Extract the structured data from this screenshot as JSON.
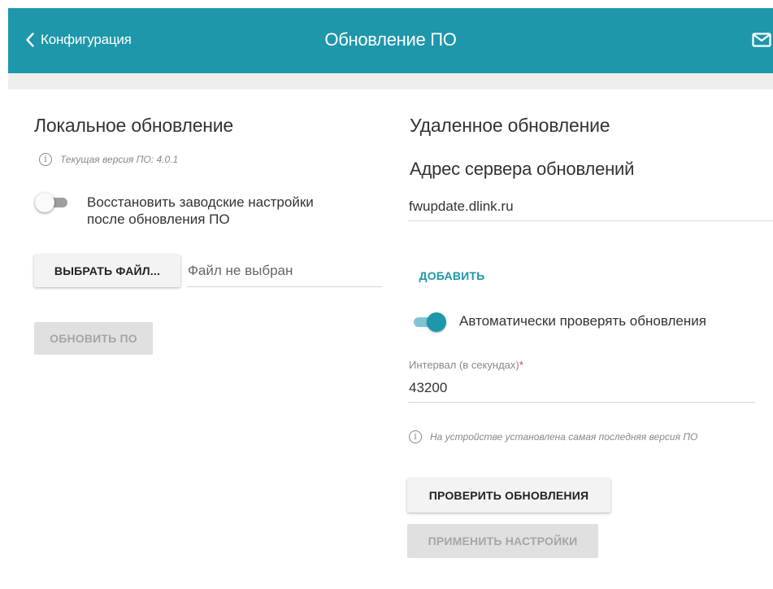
{
  "header": {
    "back_label": "Конфигурация",
    "title": "Обновление ПО",
    "accent_color": "#1e97ab",
    "icons": {
      "back": "chevron-left-icon",
      "notifications": "mail-icon"
    }
  },
  "local": {
    "title": "Локальное обновление",
    "current_version_text": "Текущая версия ПО: 4.0.1",
    "restore_defaults": {
      "label_line1": "Восстановить заводские настройки",
      "label_line2": "после обновления ПО",
      "enabled": false
    },
    "choose_file_button": "ВЫБРАТЬ ФАЙЛ...",
    "file_placeholder": "Файл не выбран",
    "update_button": "ОБНОВИТЬ ПО"
  },
  "remote": {
    "title": "Удаленное обновление",
    "server_title": "Адрес сервера обновлений",
    "server_address": "fwupdate.dlink.ru",
    "add_button": "ДОБАВИТЬ",
    "auto_check": {
      "label": "Автоматически проверять обновления",
      "enabled": true
    },
    "interval_label": "Интервал (в секундах)",
    "interval_required_mark": "*",
    "interval_value": "43200",
    "status_text": "На устройстве установлена самая последняя версия ПО",
    "check_button": "ПРОВЕРИТЬ ОБНОВЛЕНИЯ",
    "apply_button": "ПРИМЕНИТЬ НАСТРОЙКИ"
  }
}
